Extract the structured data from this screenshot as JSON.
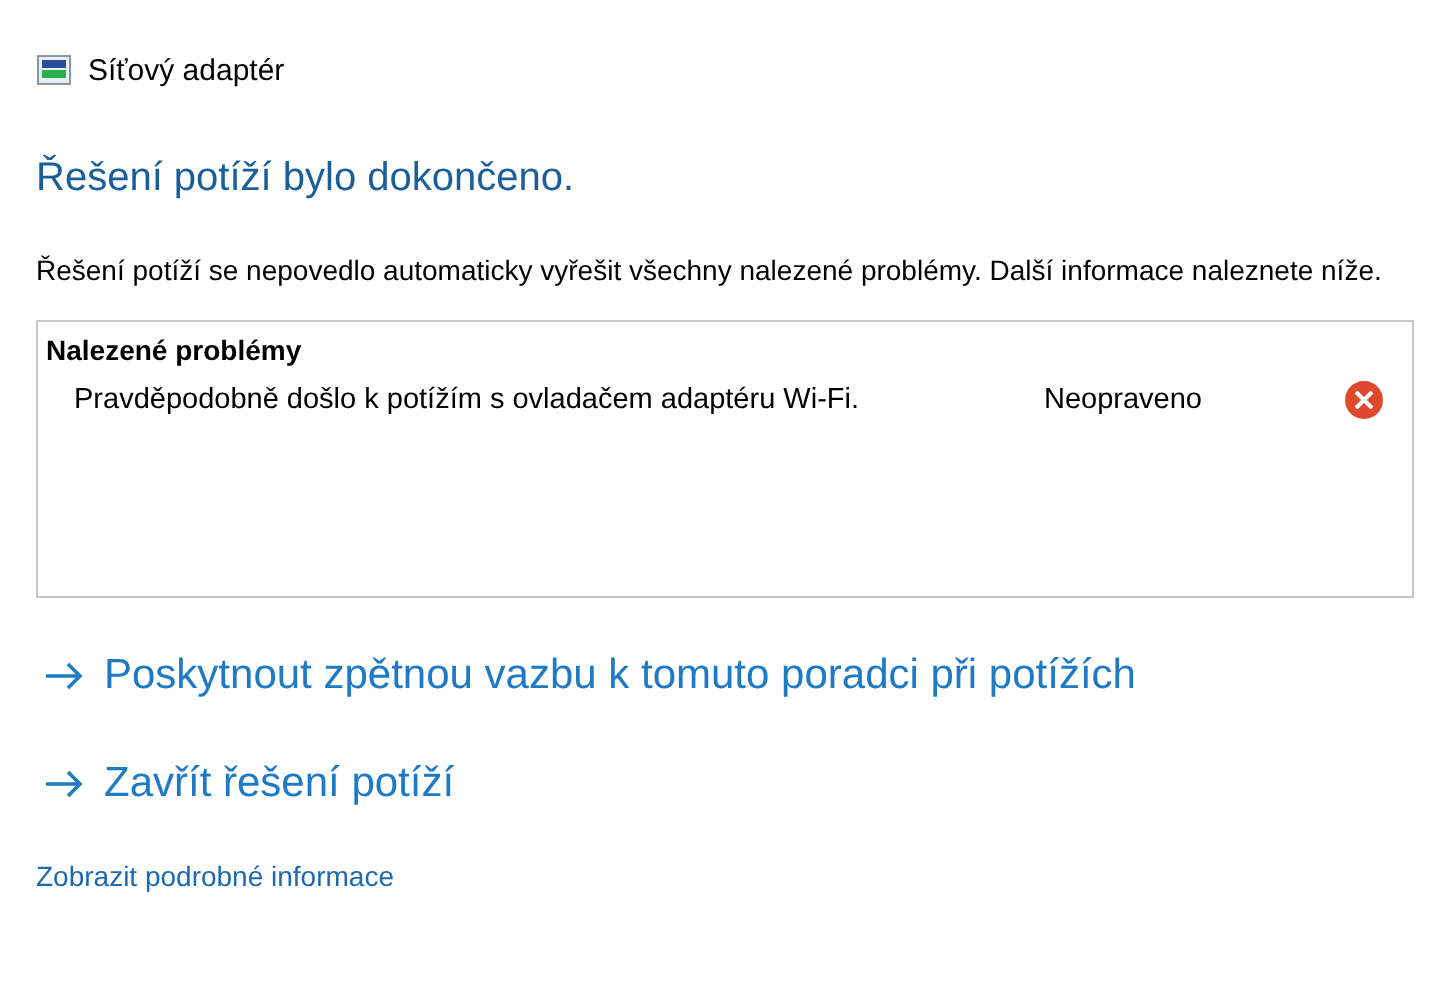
{
  "window": {
    "title": "Síťový adaptér"
  },
  "heading": "Řešení potíží bylo dokončeno.",
  "message": "Řešení potíží se nepovedlo automaticky vyřešit všechny nalezené problémy. Další informace naleznete níže.",
  "problems": {
    "title": "Nalezené problémy",
    "items": [
      {
        "text": "Pravděpodobně došlo k potížím s ovladačem adaptéru Wi-Fi.",
        "status": "Neopraveno",
        "kind": "not_fixed"
      }
    ]
  },
  "actions": [
    {
      "label": "Poskytnout zpětnou vazbu k tomuto poradci při potížích"
    },
    {
      "label": "Zavřít řešení potíží"
    }
  ],
  "details_link": "Zobrazit podrobné informace"
}
